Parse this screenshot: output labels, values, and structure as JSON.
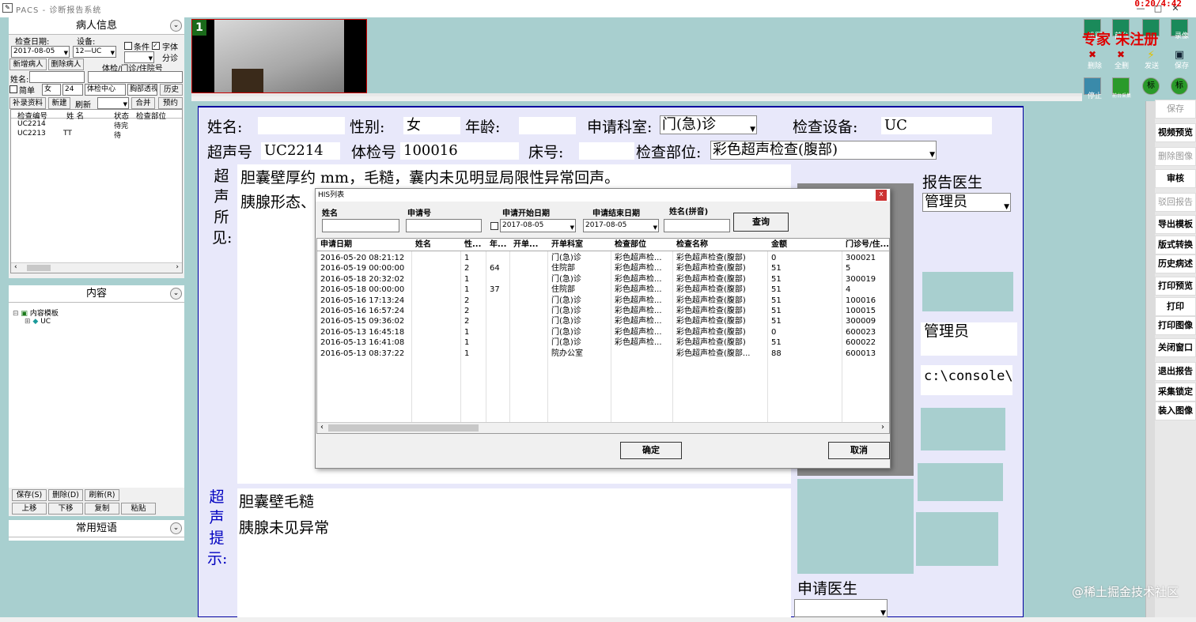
{
  "app": {
    "title": "PACS - 诊断报告系统",
    "clock": "0:20/4:42"
  },
  "left": {
    "patient_panel_title": "病人信息",
    "exam_date_label": "检查日期:",
    "exam_date_value": "2017-08-05",
    "device_label": "设备:",
    "device_value": "12—UC",
    "cond_label": "条件",
    "font_label": "字体",
    "split_label": "分诊",
    "new_patient": "新增病人",
    "delete_patient": "删除病人",
    "category_label": "体检/门诊/住院号",
    "name_label": "姓名:",
    "simple_label": "简单",
    "sex_value": "女",
    "age_value": "24",
    "center_value": "体检中心",
    "chest_label": "胸部透视",
    "history_btn": "历史",
    "supplement_btn": "补录资料",
    "new_btn": "新建",
    "refresh_btn": "刷新",
    "merge_btn": "合并",
    "reserve_btn": "预约",
    "list_headers": [
      "检查编号",
      "姓 名",
      "状态",
      "检查部位"
    ],
    "list_rows": [
      {
        "id": "UC2214",
        "name": "",
        "status": "待完"
      },
      {
        "id": "UC2213",
        "name": "TT",
        "status": "待"
      }
    ],
    "content_panel_title": "内容",
    "tree_root": "内容模板",
    "tree_child": "UC",
    "save_btn": "保存(S)",
    "delete_btn": "删除(D)",
    "refresh2_btn": "刷新(R)",
    "up_btn": "上移",
    "down_btn": "下移",
    "copy_btn": "复制",
    "paste_btn": "粘贴",
    "phrases_panel_title": "常用短语"
  },
  "strip": {
    "thumb_index": "1"
  },
  "toolbar": {
    "row1": [
      "设置",
      "前台",
      "专家",
      "录像"
    ],
    "watermark_red": "专家 未注册",
    "row2": [
      "删除",
      "全删",
      "发送",
      "保存"
    ],
    "row3": [
      "停止",
      "前台采集",
      "标",
      "标"
    ]
  },
  "report": {
    "name_label": "姓名:",
    "name_value": "",
    "sex_label": "性别:",
    "sex_value": "女",
    "age_label": "年龄:",
    "age_value": "",
    "dept_label": "申请科室:",
    "dept_value": "门(急)诊",
    "device_label": "检查设备:",
    "device_value": "UC",
    "us_no_label": "超声号",
    "us_no_value": "UC2214",
    "exam_no_label": "体检号",
    "exam_no_value": "100016",
    "bed_label": "床号:",
    "bed_value": "",
    "part_label": "检查部位:",
    "part_value": "彩色超声检查(腹部)",
    "findings_label": [
      "超",
      "声",
      "所",
      "见:"
    ],
    "findings_line1": "胆囊壁厚约 mm，毛糙，囊内未见明显局限性异常回声。",
    "findings_line2": "胰腺形态、",
    "hint_label": [
      "超",
      "声",
      "提",
      "示:"
    ],
    "hint_line1": "胆囊壁毛糙",
    "hint_line2": "胰腺未见异常",
    "report_doctor_label": "报告医生",
    "report_doctor_value": "管理员",
    "reviewer_value": "管理员",
    "path_value": "c:\\console\\",
    "apply_doctor_label": "申请医生"
  },
  "right_buttons": [
    "保存",
    "视频预览",
    "删除图像",
    "审核",
    "驳回报告",
    "导出模板",
    "版式转换",
    "历史病述",
    "打印预览",
    "打印",
    "打印图像",
    "关闭窗口",
    "退出报告",
    "采集锁定",
    "装入图像"
  ],
  "right_disabled": [
    true,
    false,
    true,
    false,
    true,
    false,
    false,
    false,
    false,
    false,
    false,
    false,
    false,
    false,
    false
  ],
  "dialog": {
    "title": "HIS列表",
    "name_label": "姓名",
    "apply_no_label": "申请号",
    "start_date_label": "申请开始日期",
    "start_date_value": "2017-08-05",
    "end_date_label": "申请结束日期",
    "end_date_value": "2017-08-05",
    "pinyin_label": "姓名(拼音)",
    "query_btn": "查询",
    "columns": [
      "申请日期",
      "姓名",
      "性...",
      "年...",
      "开单...",
      "开单科室",
      "检查部位",
      "检查名称",
      "金额",
      "门诊号/住..."
    ],
    "rows": [
      [
        "2016-05-20 08:21:12",
        "",
        "1",
        "",
        "",
        "门(急)诊",
        "彩色超声检...",
        "彩色超声检查(腹部)",
        "0",
        "300021"
      ],
      [
        "2016-05-19 00:00:00",
        "",
        "2",
        "64",
        "",
        "住院部",
        "彩色超声检...",
        "彩色超声检查(腹部)",
        "51",
        "5"
      ],
      [
        "2016-05-18 20:32:02",
        "",
        "1",
        "",
        "",
        "门(急)诊",
        "彩色超声检...",
        "彩色超声检查(腹部)",
        "51",
        "300019"
      ],
      [
        "2016-05-18 00:00:00",
        "",
        "1",
        "37",
        "",
        "住院部",
        "彩色超声检...",
        "彩色超声检查(腹部)",
        "51",
        "4"
      ],
      [
        "2016-05-16 17:13:24",
        "",
        "2",
        "",
        "",
        "门(急)诊",
        "彩色超声检...",
        "彩色超声检查(腹部)",
        "51",
        "100016"
      ],
      [
        "2016-05-16 16:57:24",
        "",
        "2",
        "",
        "",
        "门(急)诊",
        "彩色超声检...",
        "彩色超声检查(腹部)",
        "51",
        "100015"
      ],
      [
        "2016-05-15 09:36:02",
        "",
        "2",
        "",
        "",
        "门(急)诊",
        "彩色超声检...",
        "彩色超声检查(腹部)",
        "51",
        "300009"
      ],
      [
        "2016-05-13 16:45:18",
        "",
        "1",
        "",
        "",
        "门(急)诊",
        "彩色超声检...",
        "彩色超声检查(腹部)",
        "0",
        "600023"
      ],
      [
        "2016-05-13 16:41:08",
        "",
        "1",
        "",
        "",
        "门(急)诊",
        "彩色超声检...",
        "彩色超声检查(腹部)",
        "51",
        "600022"
      ],
      [
        "2016-05-13 08:37:22",
        "",
        "1",
        "",
        "",
        "院办公室",
        "",
        "彩色超声检查(腹部...",
        "88",
        "600013"
      ]
    ],
    "ok_btn": "确定",
    "cancel_btn": "取消"
  },
  "watermark": "@稀土掘金技术社区"
}
